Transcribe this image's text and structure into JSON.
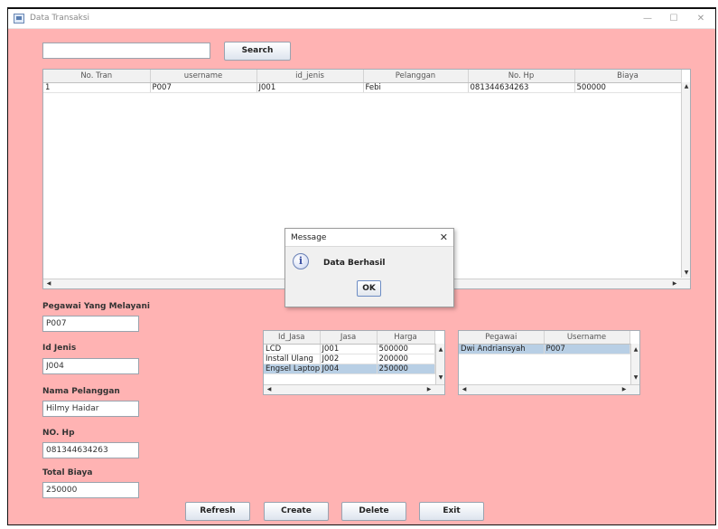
{
  "window": {
    "title": "Data Transaksi"
  },
  "search": {
    "value": "",
    "button_label": "Search"
  },
  "transactions": {
    "columns": [
      "No. Tran",
      "username",
      "id_jenis",
      "Pelanggan",
      "No. Hp",
      "Biaya"
    ],
    "rows": [
      [
        "1",
        "P007",
        "J001",
        "Febi",
        "081344634263",
        "500000"
      ]
    ]
  },
  "form": {
    "pegawai_label": "Pegawai Yang Melayani",
    "pegawai_value": "P007",
    "id_jenis_label": "Id Jenis",
    "id_jenis_value": "J004",
    "nama_label": "Nama Pelanggan",
    "nama_value": "Hilmy Haidar",
    "hp_label": "NO. Hp",
    "hp_value": "081344634263",
    "biaya_label": "Total Biaya",
    "biaya_value": "250000"
  },
  "jasa": {
    "columns": [
      "Id_Jasa",
      "Jasa",
      "Harga"
    ],
    "rows": [
      [
        "LCD",
        "J001",
        "500000"
      ],
      [
        "Install Ulang",
        "J002",
        "200000"
      ],
      [
        "Engsel Laptop",
        "J004",
        "250000"
      ]
    ],
    "selected_index": 2
  },
  "pegawai": {
    "columns": [
      "Pegawai",
      "Username"
    ],
    "rows": [
      [
        "Dwi Andriansyah",
        "P007"
      ]
    ],
    "selected_index": 0
  },
  "buttons": {
    "refresh": "Refresh",
    "create": "Create",
    "delete": "Delete",
    "exit": "Exit"
  },
  "dialog": {
    "title": "Message",
    "message": "Data Berhasil",
    "ok": "OK"
  },
  "colors": {
    "background": "#ffb3b3",
    "selection": "#b8cfe5"
  }
}
